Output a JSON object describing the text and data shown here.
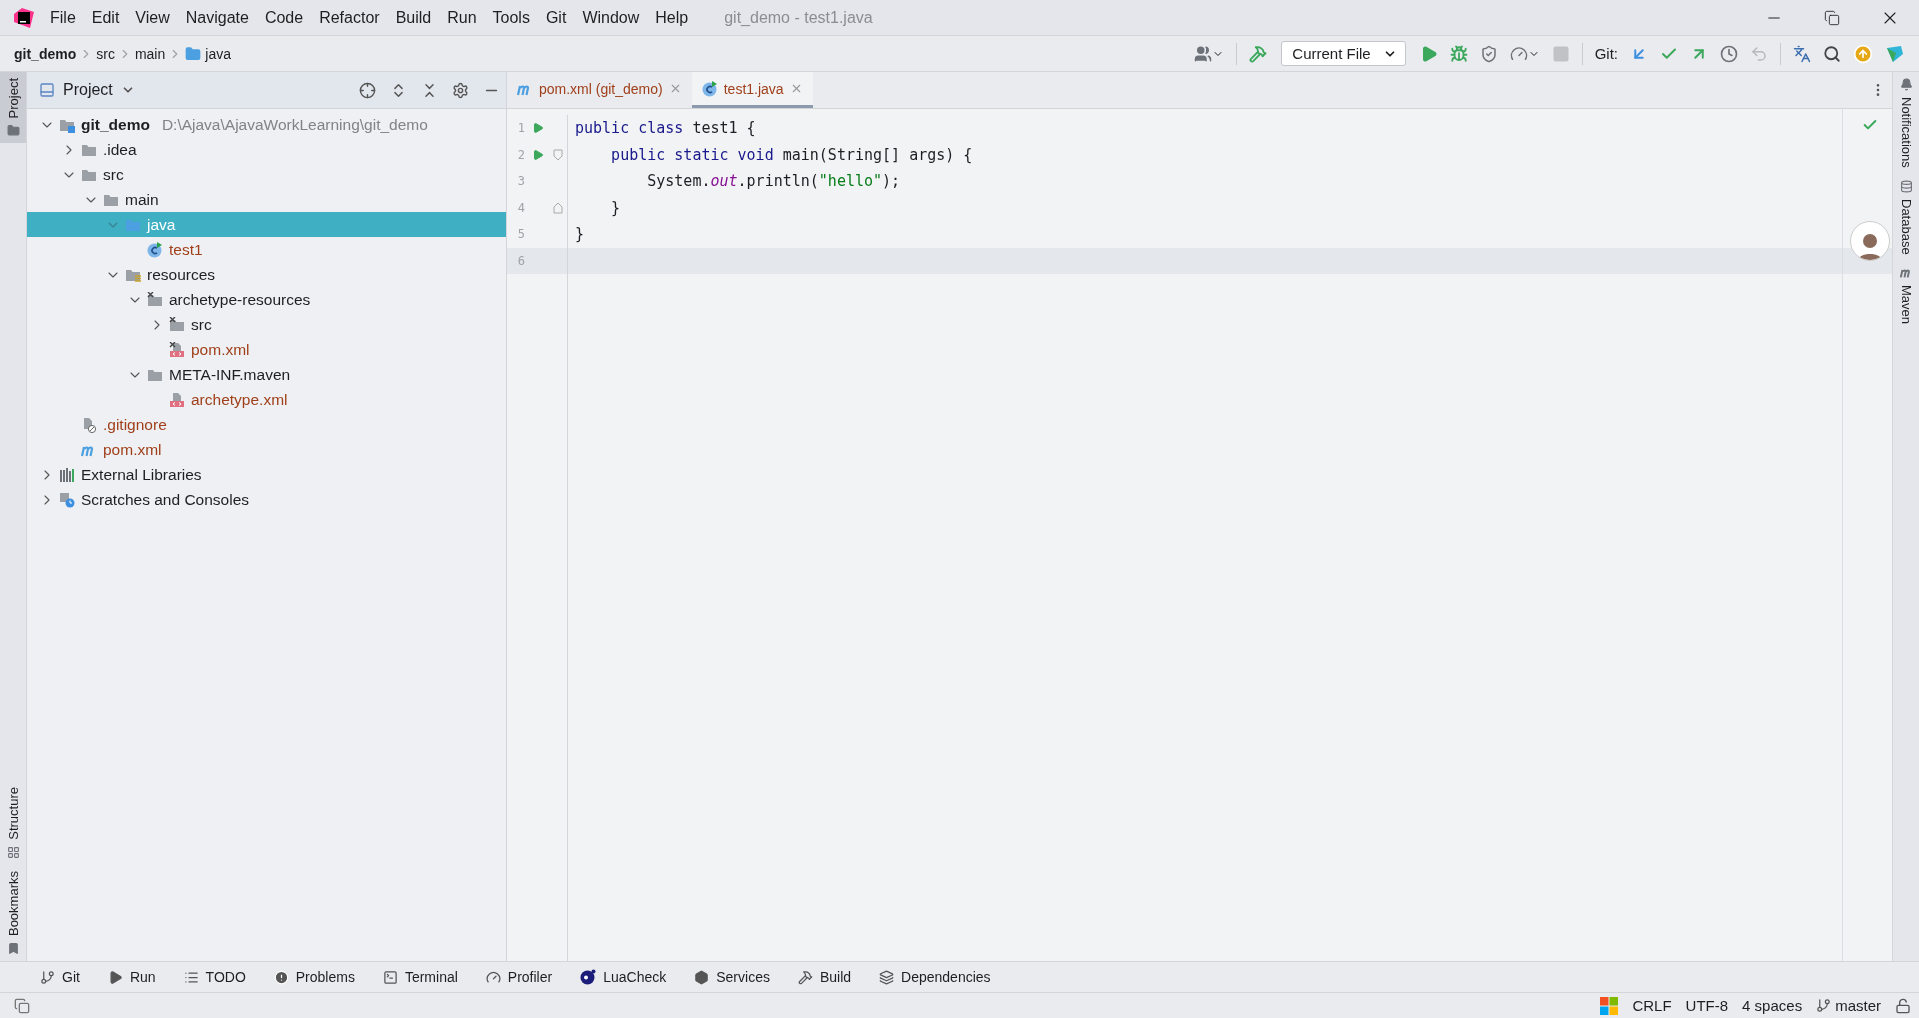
{
  "window": {
    "title": "git_demo - test1.java"
  },
  "menu": [
    "File",
    "Edit",
    "View",
    "Navigate",
    "Code",
    "Refactor",
    "Build",
    "Run",
    "Tools",
    "Git",
    "Window",
    "Help"
  ],
  "breadcrumbs": [
    {
      "label": "git_demo",
      "kind": "root"
    },
    {
      "label": "src",
      "kind": "plain"
    },
    {
      "label": "main",
      "kind": "plain"
    },
    {
      "label": "java",
      "kind": "folder"
    }
  ],
  "toolbar": [
    {
      "kind": "account"
    },
    {
      "kind": "separator"
    },
    {
      "kind": "build"
    },
    {
      "kind": "config",
      "label": "Current File"
    },
    {
      "kind": "run"
    },
    {
      "kind": "debug"
    },
    {
      "kind": "coverage"
    },
    {
      "kind": "profile"
    },
    {
      "kind": "stop",
      "disabled": true
    },
    {
      "kind": "separator"
    },
    {
      "kind": "label",
      "label": "Git:"
    },
    {
      "kind": "git-update"
    },
    {
      "kind": "git-commit"
    },
    {
      "kind": "git-push"
    },
    {
      "kind": "history"
    },
    {
      "kind": "rollback",
      "disabled": true
    },
    {
      "kind": "separator"
    },
    {
      "kind": "translate"
    },
    {
      "kind": "search"
    },
    {
      "kind": "ide-update"
    },
    {
      "kind": "toolbox"
    }
  ],
  "left_stripe": [
    {
      "label": "Project",
      "selected": true,
      "kind": "project"
    },
    {
      "label": "Structure",
      "selected": false,
      "kind": "structure"
    },
    {
      "label": "Bookmarks",
      "selected": false,
      "kind": "bookmarks"
    }
  ],
  "right_stripe": [
    {
      "label": "Notifications",
      "kind": "notifications"
    },
    {
      "label": "Database",
      "kind": "database"
    },
    {
      "label": "Maven",
      "kind": "maven"
    }
  ],
  "project_panel": {
    "title": "Project",
    "tree": [
      {
        "label": "git_demo",
        "hint": "D:\\Ajava\\AjavaWorkLearning\\git_demo",
        "kind": "module-folder",
        "expanded": true,
        "selected": false,
        "unversioned": false,
        "children": [
          {
            "label": ".idea",
            "kind": "folder",
            "expanded": false,
            "selected": false,
            "unversioned": false
          },
          {
            "label": "src",
            "kind": "folder",
            "expanded": true,
            "selected": false,
            "unversioned": false,
            "children": [
              {
                "label": "main",
                "kind": "folder",
                "expanded": true,
                "selected": false,
                "unversioned": false,
                "children": [
                  {
                    "label": "java",
                    "kind": "source-folder",
                    "expanded": true,
                    "selected": true,
                    "unversioned": false,
                    "children": [
                      {
                        "label": "test1",
                        "kind": "class",
                        "selected": false,
                        "unversioned": true
                      }
                    ]
                  },
                  {
                    "label": "resources",
                    "kind": "resources-folder",
                    "expanded": true,
                    "selected": false,
                    "unversioned": false,
                    "children": [
                      {
                        "label": "archetype-resources",
                        "kind": "excluded-folder",
                        "expanded": true,
                        "selected": false,
                        "unversioned": false,
                        "children": [
                          {
                            "label": "src",
                            "kind": "excluded-folder",
                            "expanded": false,
                            "selected": false,
                            "unversioned": false
                          },
                          {
                            "label": "pom.xml",
                            "kind": "excluded-xml",
                            "selected": false,
                            "unversioned": true
                          }
                        ]
                      },
                      {
                        "label": "META-INF.maven",
                        "kind": "folder",
                        "expanded": true,
                        "selected": false,
                        "unversioned": false,
                        "children": [
                          {
                            "label": "archetype.xml",
                            "kind": "xml",
                            "selected": false,
                            "unversioned": true
                          }
                        ]
                      }
                    ]
                  }
                ]
              }
            ]
          },
          {
            "label": ".gitignore",
            "kind": "gitignore",
            "selected": false,
            "unversioned": true
          },
          {
            "label": "pom.xml",
            "kind": "maven",
            "selected": false,
            "unversioned": true
          }
        ]
      },
      {
        "label": "External Libraries",
        "kind": "libraries",
        "expanded": false,
        "selected": false,
        "unversioned": false
      },
      {
        "label": "Scratches and Consoles",
        "kind": "scratches",
        "expanded": false,
        "selected": false,
        "unversioned": false
      }
    ]
  },
  "editor": {
    "tabs": [
      {
        "label": "pom.xml (git_demo)",
        "kind": "maven",
        "selected": false
      },
      {
        "label": "test1.java",
        "kind": "class",
        "selected": true
      }
    ],
    "lines": [
      {
        "number": "1",
        "run": true,
        "kind": "plain",
        "current": false,
        "tokens": [
          {
            "kind": "keyword",
            "text": "public class "
          },
          {
            "kind": "plain",
            "text": "test1 {"
          }
        ]
      },
      {
        "number": "2",
        "run": true,
        "kind": "fold-start",
        "current": false,
        "tokens": [
          {
            "kind": "keyword",
            "text": "    public static void "
          },
          {
            "kind": "plain",
            "text": "main(String[] args) {"
          }
        ]
      },
      {
        "number": "3",
        "run": false,
        "kind": "plain",
        "current": false,
        "tokens": [
          {
            "kind": "plain",
            "text": "        System."
          },
          {
            "kind": "field",
            "text": "out"
          },
          {
            "kind": "plain",
            "text": ".println("
          },
          {
            "kind": "string",
            "text": "\"hello\""
          },
          {
            "kind": "plain",
            "text": ");"
          }
        ]
      },
      {
        "number": "4",
        "run": false,
        "kind": "fold-end",
        "current": false,
        "tokens": [
          {
            "kind": "plain",
            "text": "    }"
          }
        ]
      },
      {
        "number": "5",
        "run": false,
        "kind": "plain",
        "current": false,
        "tokens": [
          {
            "kind": "plain",
            "text": "}"
          }
        ]
      },
      {
        "number": "6",
        "run": false,
        "kind": "plain",
        "current": true
      }
    ]
  },
  "tool_windows": [
    {
      "label": "Git",
      "kind": "git"
    },
    {
      "label": "Run",
      "kind": "run"
    },
    {
      "label": "TODO",
      "kind": "todo"
    },
    {
      "label": "Problems",
      "kind": "problems"
    },
    {
      "label": "Terminal",
      "kind": "terminal"
    },
    {
      "label": "Profiler",
      "kind": "profiler"
    },
    {
      "label": "LuaCheck",
      "kind": "lua"
    },
    {
      "label": "Services",
      "kind": "services"
    },
    {
      "label": "Build",
      "kind": "build"
    },
    {
      "label": "Dependencies",
      "kind": "dependencies"
    }
  ],
  "status_bar": [
    {
      "kind": "windows"
    },
    {
      "kind": "text",
      "label": "CRLF"
    },
    {
      "kind": "text",
      "label": "UTF-8"
    },
    {
      "kind": "text",
      "label": "4 spaces"
    },
    {
      "kind": "branch",
      "label": "master"
    },
    {
      "kind": "lock"
    }
  ]
}
